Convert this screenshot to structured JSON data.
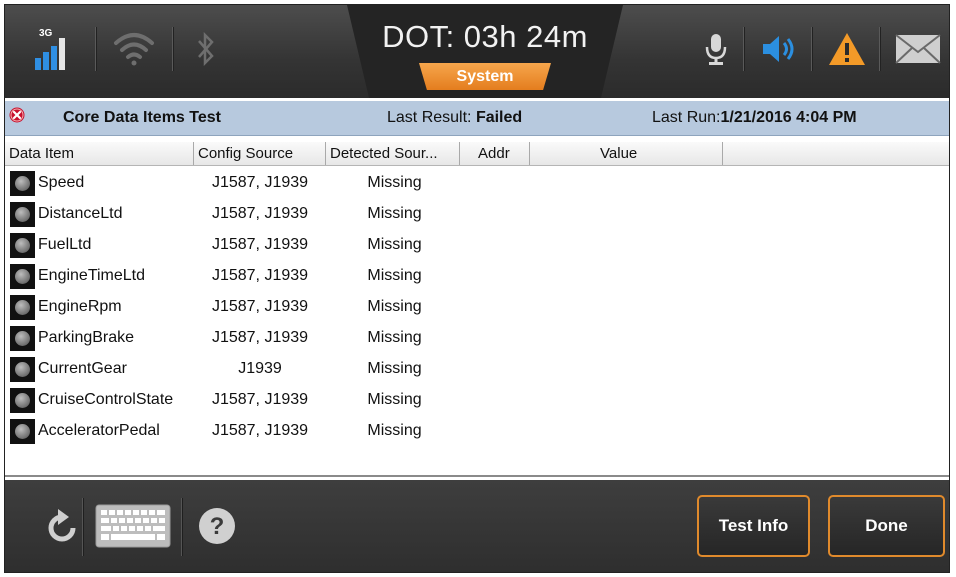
{
  "topbar": {
    "signal_label": "3G",
    "dot_text": "DOT: 03h 24m",
    "system_tab": "System",
    "icons": [
      "signal-icon",
      "wifi-icon",
      "bluetooth-icon",
      "microphone-icon",
      "speaker-icon",
      "warning-icon",
      "mail-icon"
    ],
    "accent_color": "#e8892a",
    "speaker_color": "#2b8fe0"
  },
  "test": {
    "title": "Core Data Items Test",
    "last_result_label": "Last Result:",
    "last_result_value": "Failed",
    "last_run_label": "Last Run:",
    "last_run_value": "1/21/2016 4:04 PM"
  },
  "table": {
    "columns": [
      "Data Item",
      "Config Source",
      "Detected Sour...",
      "Addr",
      "Value"
    ],
    "rows": [
      {
        "name": "Speed",
        "config": "J1587, J1939",
        "detected": "Missing"
      },
      {
        "name": "DistanceLtd",
        "config": "J1587, J1939",
        "detected": "Missing"
      },
      {
        "name": "FuelLtd",
        "config": "J1587, J1939",
        "detected": "Missing"
      },
      {
        "name": "EngineTimeLtd",
        "config": "J1587, J1939",
        "detected": "Missing"
      },
      {
        "name": "EngineRpm",
        "config": "J1587, J1939",
        "detected": "Missing"
      },
      {
        "name": "ParkingBrake",
        "config": "J1587, J1939",
        "detected": "Missing"
      },
      {
        "name": "CurrentGear",
        "config": "J1939",
        "detected": "Missing"
      },
      {
        "name": "CruiseControlState",
        "config": "J1587, J1939",
        "detected": "Missing"
      },
      {
        "name": "AcceleratorPedal",
        "config": "J1587, J1939",
        "detected": "Missing"
      }
    ]
  },
  "bottombar": {
    "test_info_label": "Test Info",
    "done_label": "Done",
    "help_glyph": "?",
    "icons": [
      "refresh-icon",
      "keyboard-icon",
      "help-icon"
    ]
  }
}
